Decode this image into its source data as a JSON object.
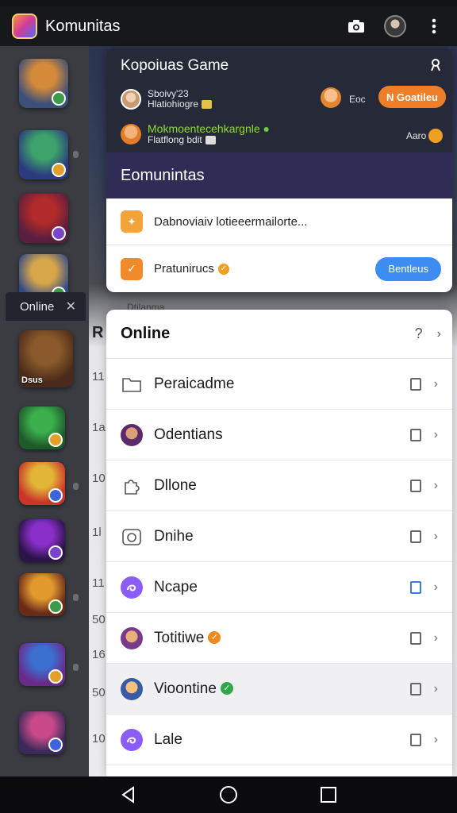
{
  "app_bar": {
    "title": "Komunitas"
  },
  "rail": {
    "online_tab": {
      "label": "Online",
      "close_glyph": "✕"
    },
    "games": [
      {
        "colors": [
          "#d58a3a",
          "#3a4f7a"
        ],
        "badge": "#3b9b46"
      },
      {
        "colors": [
          "#3ea26b",
          "#2b3b7e"
        ],
        "badge": "#e0a02a"
      },
      {
        "colors": [
          "#b22a2a",
          "#5a1f3f"
        ],
        "badge": "#7a44c9"
      },
      {
        "colors": [
          "#d7a64b",
          "#314a86"
        ],
        "badge": "#3b9b46"
      },
      {
        "colors": [
          "#8a5a2a",
          "#4a2a1a"
        ],
        "label": "Dsus"
      },
      {
        "colors": [
          "#3bb04c",
          "#1f5a2a"
        ],
        "badge": "#e0a02a"
      },
      {
        "colors": [
          "#e2b537",
          "#c9352b"
        ],
        "badge": "#3a64d8"
      },
      {
        "colors": [
          "#8a2fc9",
          "#2a1448"
        ],
        "badge": "#7a44c9"
      },
      {
        "colors": [
          "#e29a2f",
          "#6a2a18"
        ],
        "badge": "#3b9b46"
      },
      {
        "colors": [
          "#3b6fd0",
          "#6a2a8a"
        ],
        "badge": "#e0a02a"
      },
      {
        "colors": [
          "#c94a8a",
          "#3a2a5a"
        ],
        "badge": "#3a64d8"
      }
    ]
  },
  "background": {
    "header_letter": "R",
    "faint_text": "Dtilanma",
    "row_numbers": [
      "11",
      "1a",
      "10",
      "1l",
      "11",
      "50",
      "16",
      "50",
      "10"
    ]
  },
  "top_card": {
    "title": "Kopoiuas Game",
    "row1": {
      "line1": "Sboivy'23",
      "line2": "Hlatiohiogre"
    },
    "row2": {
      "line1": "Mokmoentecehkargnle",
      "line2": "Flatflong bdit"
    },
    "side_text_1": "Eoc",
    "side_text_2": "Aaro",
    "pill_label": "N Goatileu",
    "section_title": "Eomunintas",
    "row_a": "Dabnoviaiv lotieeermailorte...",
    "row_b": "Pratunirucs",
    "blue_button": "Bentleus"
  },
  "online_panel": {
    "title": "Online",
    "help_glyph": "?",
    "rows": [
      {
        "label": "Peraicadme",
        "icon": "folder-icon",
        "checked": false
      },
      {
        "label": "Odentians",
        "icon": "avatar-icon",
        "checked": false
      },
      {
        "label": "Dllone",
        "icon": "puzzle-icon",
        "checked": false
      },
      {
        "label": "Dnihe",
        "icon": "camera-icon",
        "checked": false
      },
      {
        "label": "Ncape",
        "icon": "swirl-icon",
        "checked": true
      },
      {
        "label": "Totitiwe",
        "icon": "avatar-icon",
        "checked": false,
        "verify": "#f08a20"
      },
      {
        "label": "Vioontine",
        "icon": "avatar-icon",
        "checked": false,
        "verify": "#2fa84a"
      },
      {
        "label": "Lale",
        "icon": "swirl-icon",
        "checked": false
      }
    ]
  }
}
